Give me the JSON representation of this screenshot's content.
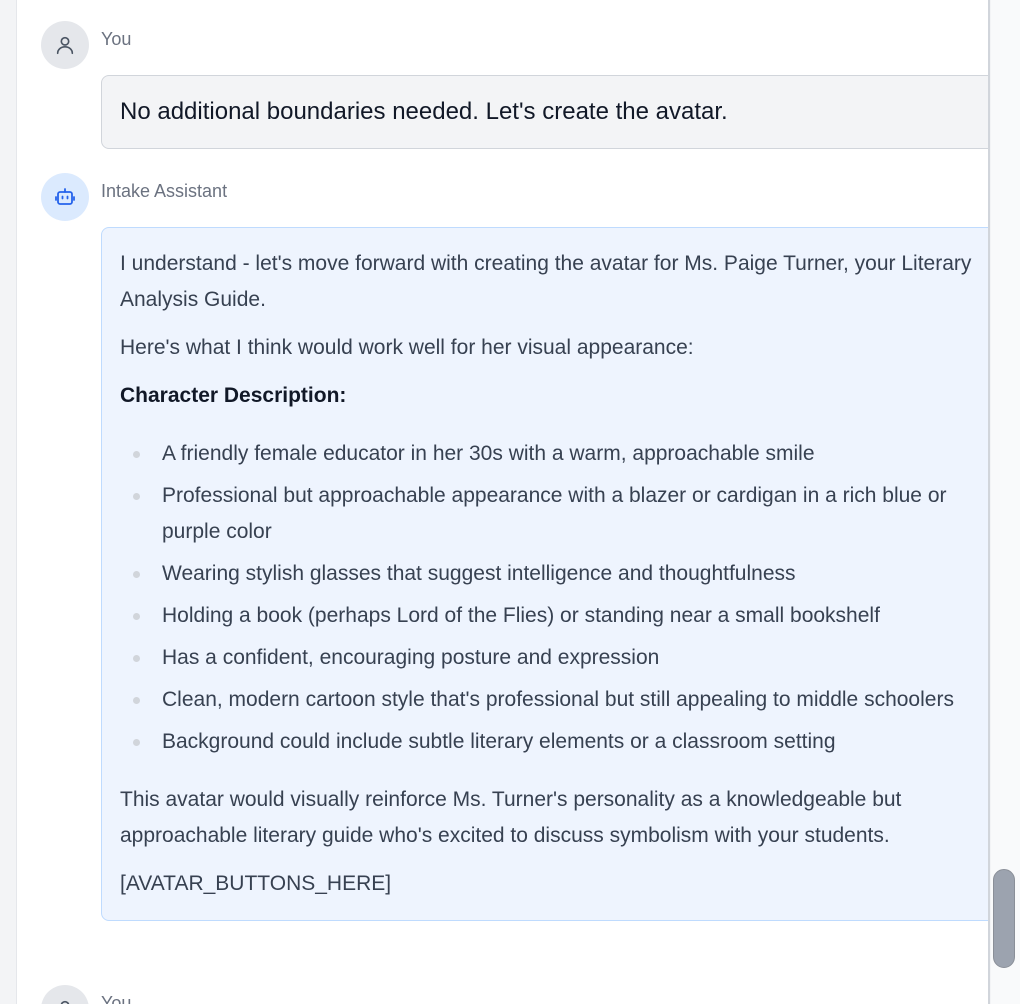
{
  "messages": [
    {
      "role": "user",
      "sender": "You",
      "icon": "user-icon",
      "text": "No additional boundaries needed. Let's create the avatar."
    },
    {
      "role": "assistant",
      "sender": "Intake Assistant",
      "icon": "robot-icon",
      "intro": "I understand - let's move forward with creating the avatar for Ms. Paige Turner, your Literary Analysis Guide.",
      "lead": "Here's what I think would work well for her visual appearance:",
      "heading": "Character Description:",
      "bullets": [
        "A friendly female educator in her 30s with a warm, approachable smile",
        "Professional but approachable appearance with a blazer or cardigan in a rich blue or purple color",
        "Wearing stylish glasses that suggest intelligence and thoughtfulness",
        "Holding a book (perhaps Lord of the Flies) or standing near a small bookshelf",
        "Has a confident, encouraging posture and expression",
        "Clean, modern cartoon style that's professional but still appealing to middle schoolers",
        "Background could include subtle literary elements or a classroom setting"
      ],
      "closing": "This avatar would visually reinforce Ms. Turner's personality as a knowledgeable but approachable literary guide who's excited to discuss symbolism with your students.",
      "placeholder": "[AVATAR_BUTTONS_HERE]"
    },
    {
      "role": "user",
      "sender": "You",
      "icon": "user-icon"
    }
  ],
  "colors": {
    "assistant_bubble": "#eef4fe",
    "assistant_border": "#bfdbfe",
    "user_bubble": "#f3f4f6",
    "accent": "#2563eb"
  }
}
